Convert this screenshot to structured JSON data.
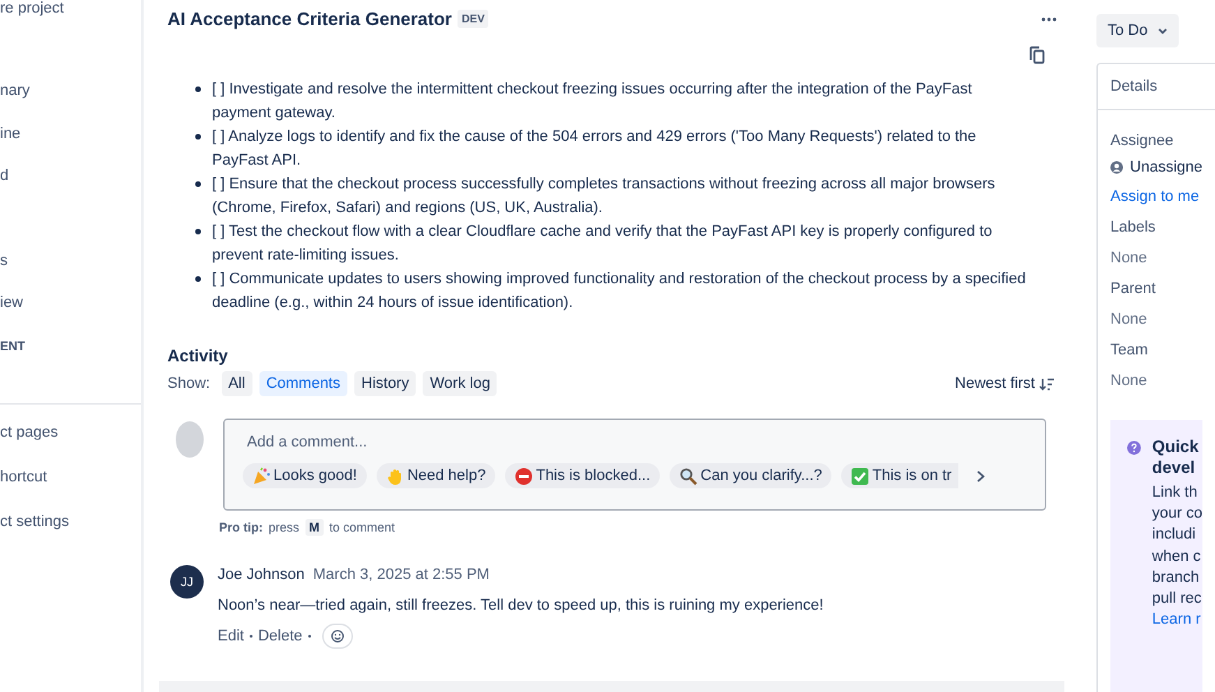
{
  "sidebar": {
    "header": "re project",
    "items": [
      {
        "label": "nary"
      },
      {
        "label": "ine"
      },
      {
        "label": "d"
      },
      {
        "label": "s"
      },
      {
        "label": "iew"
      },
      {
        "label": "ENT"
      }
    ],
    "footer_items": [
      {
        "label": "ct pages"
      },
      {
        "label": "hortcut"
      },
      {
        "label": "ct settings"
      }
    ]
  },
  "issue": {
    "title": "AI Acceptance Criteria Generator",
    "badge": "DEV",
    "criteria": [
      "[ ] Investigate and resolve the intermittent checkout freezing issues occurring after the integration of the PayFast payment gateway.",
      "[ ] Analyze logs to identify and fix the cause of the 504 errors and 429 errors ('Too Many Requests') related to the PayFast API.",
      "[ ] Ensure that the checkout process successfully completes transactions without freezing across all major browsers (Chrome, Firefox, Safari) and regions (US, UK, Australia).",
      "[ ] Test the checkout flow with a clear Cloudflare cache and verify that the PayFast API key is properly configured to prevent rate-limiting issues.",
      "[ ] Communicate updates to users showing improved functionality and restoration of the checkout process by a specified deadline (e.g., within 24 hours of issue identification)."
    ]
  },
  "activity": {
    "title": "Activity",
    "show_label": "Show:",
    "filters": [
      {
        "label": "All",
        "selected": false
      },
      {
        "label": "Comments",
        "selected": true
      },
      {
        "label": "History",
        "selected": false
      },
      {
        "label": "Work log",
        "selected": false
      }
    ],
    "sort": "Newest first",
    "comment_box": {
      "placeholder": "Add a comment...",
      "suggestions": [
        {
          "kind": "party",
          "label": "Looks good!"
        },
        {
          "kind": "wave",
          "label": "Need help?"
        },
        {
          "kind": "stop",
          "label": "This is blocked..."
        },
        {
          "kind": "search",
          "label": "Can you clarify...?"
        },
        {
          "kind": "check",
          "label": "This is on tr"
        }
      ]
    },
    "pro_tip": {
      "label": "Pro tip:",
      "before": "press",
      "key": "M",
      "after": "to comment"
    },
    "comments": [
      {
        "initials": "JJ",
        "author": "Joe Johnson",
        "time": "March 3, 2025 at 2:55 PM",
        "body": "Noon’s near—tried again, still freezes. Tell dev to speed up, this is ruining my experience!",
        "actions": [
          "Edit",
          "Delete"
        ]
      }
    ]
  },
  "details": {
    "status": "To Do",
    "title": "Details",
    "assignee": {
      "label": "Assignee",
      "value": "Unassigne",
      "link": "Assign to me"
    },
    "fields": [
      {
        "label": "Labels",
        "value": "None"
      },
      {
        "label": "Parent",
        "value": "None"
      },
      {
        "label": "Team",
        "value": "None"
      }
    ],
    "promo": {
      "title_lines": [
        "Quick",
        "devel"
      ],
      "body_lines": [
        "Link th",
        "your co",
        "includi",
        "when c",
        "branch",
        "pull rec"
      ],
      "link": "Learn r"
    }
  }
}
